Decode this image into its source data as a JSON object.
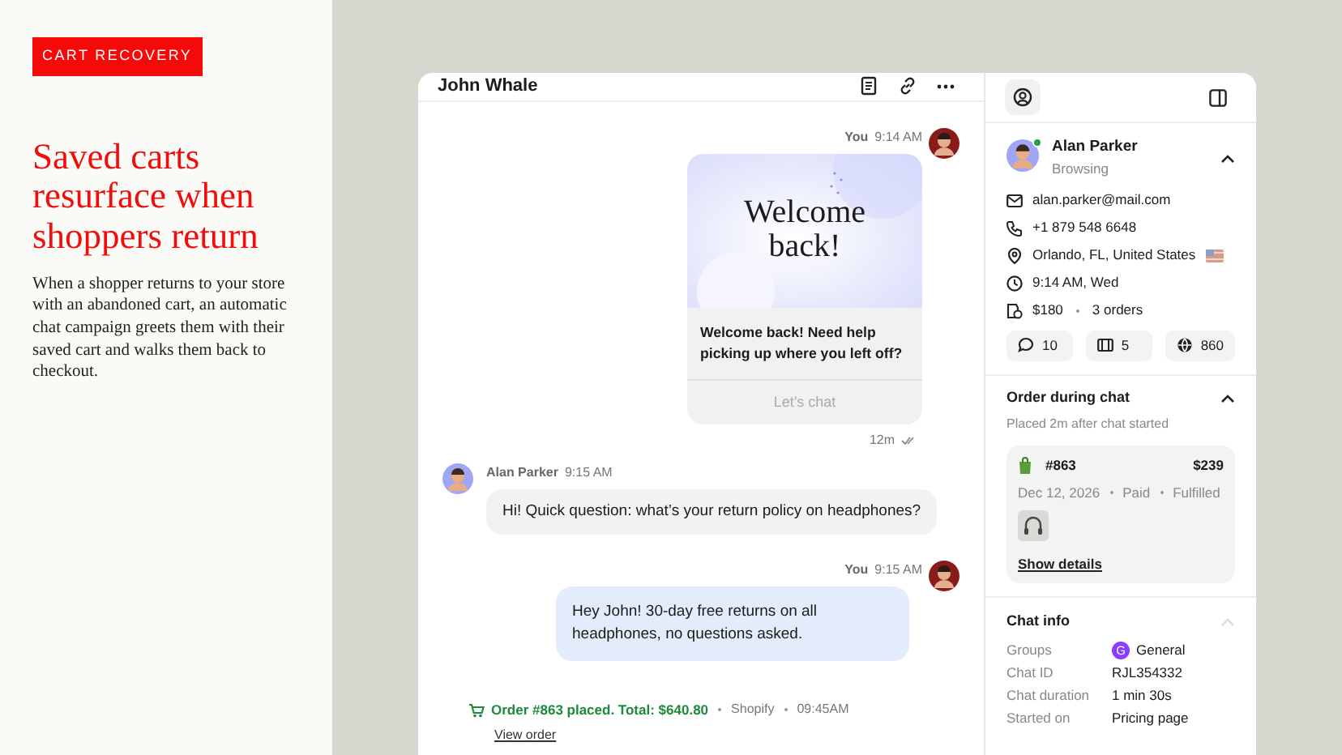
{
  "promo": {
    "tag": "CART RECOVERY",
    "headline": "Saved carts resurface when shoppers return",
    "body": "When a shopper returns to your store with an abandoned cart, an automatic chat campaign greets them with their saved cart and walks them back to checkout."
  },
  "chat": {
    "title": "John Whale",
    "messages": [
      {
        "kind": "card",
        "sender": "You",
        "time": "9:14 AM",
        "image_text": "Welcome back!",
        "text": "Welcome back! Need help picking up where you left off?",
        "button": "Let’s chat",
        "status": "12m"
      },
      {
        "kind": "incoming",
        "sender": "Alan Parker",
        "time": "9:15 AM",
        "text": "Hi! Quick question: what’s your return policy on headphones?"
      },
      {
        "kind": "outgoing",
        "sender": "You",
        "time": "9:15 AM",
        "text": "Hey John! 30-day free returns on all headphones, no questions asked."
      },
      {
        "kind": "event",
        "text": "Order #863 placed. Total: $640.80",
        "source": "Shopify",
        "time": "09:45AM",
        "link": "View order"
      }
    ]
  },
  "customer": {
    "name": "Alan Parker",
    "status": "Browsing",
    "online": true,
    "expanded": true,
    "details": [
      {
        "kind": "email",
        "text": "alan.parker@mail.com"
      },
      {
        "kind": "phone",
        "text": "+1 879 548 6648"
      },
      {
        "kind": "location",
        "text": "Orlando, FL, United States"
      },
      {
        "kind": "time",
        "text": "9:14 AM, Wed"
      },
      {
        "kind": "orders",
        "text": "$180",
        "extra": "3 orders"
      }
    ],
    "stats": [
      {
        "kind": "chats",
        "text": "10"
      },
      {
        "kind": "tickets",
        "text": "5"
      },
      {
        "kind": "visits",
        "text": "860"
      }
    ]
  },
  "order_section": {
    "title": "Order during chat",
    "expanded": true,
    "subtitle": "Placed 2m after chat started",
    "order": {
      "number": "#863",
      "total": "$239",
      "date": "Dec 12, 2026",
      "payment": "Paid",
      "fulfillment": "Fulfilled",
      "link": "Show details"
    }
  },
  "chat_info": {
    "title": "Chat info",
    "expanded": true,
    "rows": [
      {
        "label": "Groups",
        "value": "General",
        "badge": "G",
        "color": "#8b3dff"
      },
      {
        "label": "Chat ID",
        "value": "RJL354332"
      },
      {
        "label": "Chat duration",
        "value": "1 min 30s"
      },
      {
        "label": "Started on",
        "value": "Pricing page"
      }
    ]
  }
}
